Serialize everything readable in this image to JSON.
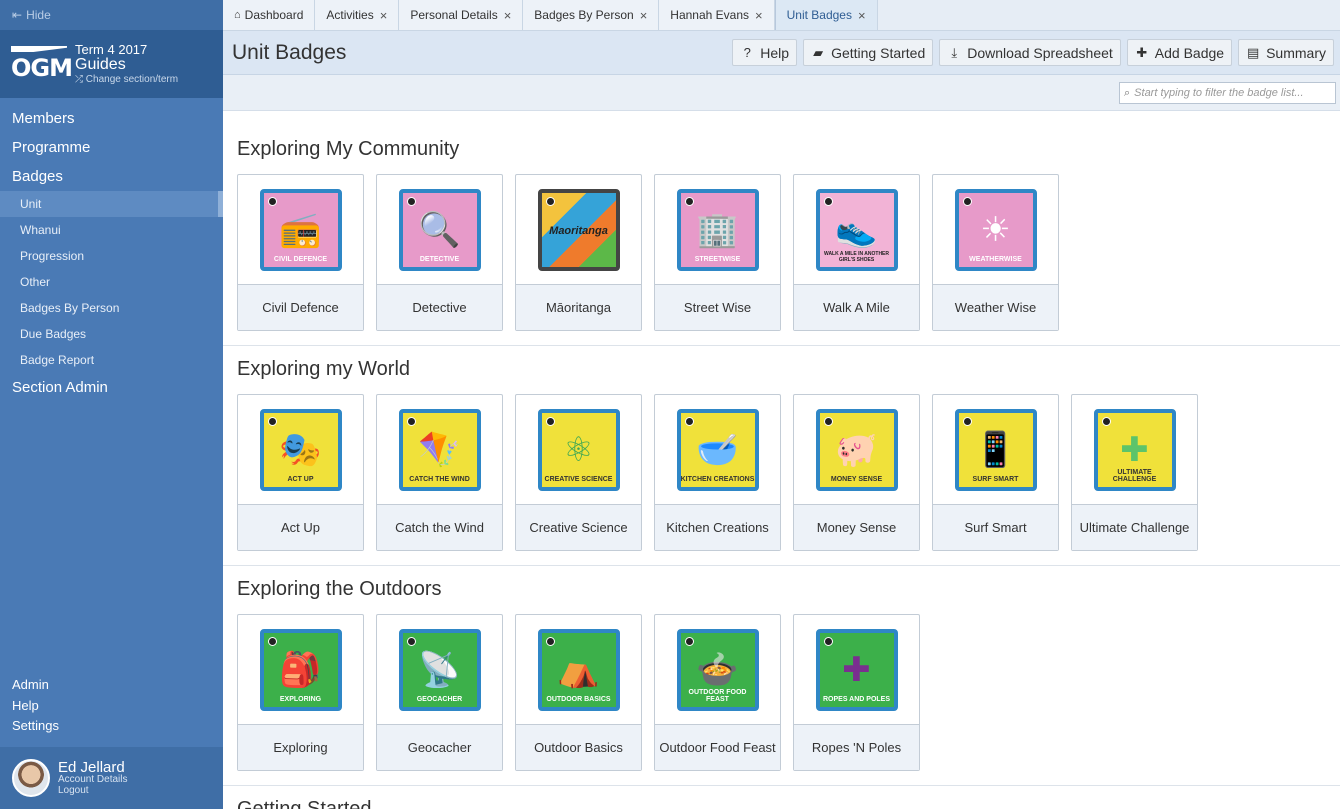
{
  "sidebar": {
    "hide_label": "Hide",
    "logo_text": "OGM",
    "term": "Term 4 2017",
    "section": "Guides",
    "change_section": "Change section/term",
    "nav": {
      "members": "Members",
      "programme": "Programme",
      "badges": "Badges",
      "badge_items": [
        "Unit",
        "Whanui",
        "Progression",
        "Other",
        "Badges By Person",
        "Due Badges",
        "Badge Report"
      ],
      "section_admin": "Section Admin"
    },
    "bottom": [
      "Admin",
      "Help",
      "Settings"
    ],
    "user": {
      "name": "Ed Jellard",
      "account_details": "Account Details",
      "logout": "Logout"
    }
  },
  "tabs": [
    "Dashboard",
    "Activities",
    "Personal Details",
    "Badges By Person",
    "Hannah Evans",
    "Unit Badges"
  ],
  "header": {
    "title": "Unit Badges",
    "actions": [
      "Help",
      "Getting Started",
      "Download Spreadsheet",
      "Add Badge",
      "Summary"
    ]
  },
  "filter": {
    "placeholder": "Start typing to filter the badge list..."
  },
  "categories": [
    {
      "title": "Exploring My Community",
      "badges": [
        {
          "label": "Civil Defence",
          "patch_text": "CIVIL DEFENCE",
          "glyph": "📻"
        },
        {
          "label": "Detective",
          "patch_text": "DETECTIVE",
          "glyph": "🔍"
        },
        {
          "label": "Māoritanga",
          "patch_text": "Maoritanga",
          "glyph": ""
        },
        {
          "label": "Street Wise",
          "patch_text": "STREETWISE",
          "glyph": "🏢"
        },
        {
          "label": "Walk A Mile",
          "patch_text": "WALK A MILE IN ANOTHER GIRL'S SHOES",
          "glyph": "👟"
        },
        {
          "label": "Weather Wise",
          "patch_text": "WEATHERWISE",
          "glyph": "☀"
        }
      ]
    },
    {
      "title": "Exploring my World",
      "badges": [
        {
          "label": "Act Up",
          "patch_text": "ACT UP",
          "glyph": "🎭"
        },
        {
          "label": "Catch the Wind",
          "patch_text": "CATCH THE WIND",
          "glyph": "🪁"
        },
        {
          "label": "Creative Science",
          "patch_text": "CREATIVE SCIENCE",
          "glyph": "⚛"
        },
        {
          "label": "Kitchen Creations",
          "patch_text": "KITCHEN CREATIONS",
          "glyph": "🥣"
        },
        {
          "label": "Money Sense",
          "patch_text": "MONEY SENSE",
          "glyph": "🐖"
        },
        {
          "label": "Surf Smart",
          "patch_text": "SURF SMART",
          "glyph": "📱"
        },
        {
          "label": "Ultimate Challenge",
          "patch_text": "ULTIMATE CHALLENGE",
          "glyph": "✚"
        }
      ]
    },
    {
      "title": "Exploring the Outdoors",
      "badges": [
        {
          "label": "Exploring",
          "patch_text": "EXPLORING",
          "glyph": "🎒"
        },
        {
          "label": "Geocacher",
          "patch_text": "GEOCACHER",
          "glyph": "📡"
        },
        {
          "label": "Outdoor Basics",
          "patch_text": "OUTDOOR BASICS",
          "glyph": "⛺"
        },
        {
          "label": "Outdoor Food Feast",
          "patch_text": "OUTDOOR FOOD FEAST",
          "glyph": "🍲"
        },
        {
          "label": "Ropes 'N Poles",
          "patch_text": "ROPES AND POLES",
          "glyph": "✚"
        }
      ]
    },
    {
      "title": "Getting Started",
      "badges": []
    }
  ],
  "colors": {
    "sidebar": "#4a7ab5",
    "header": "#dbe6f3",
    "community_patch": "#e79ac9",
    "world_patch": "#f0e13a",
    "outdoors_patch": "#3cb04a",
    "patch_border": "#2f87c6"
  }
}
